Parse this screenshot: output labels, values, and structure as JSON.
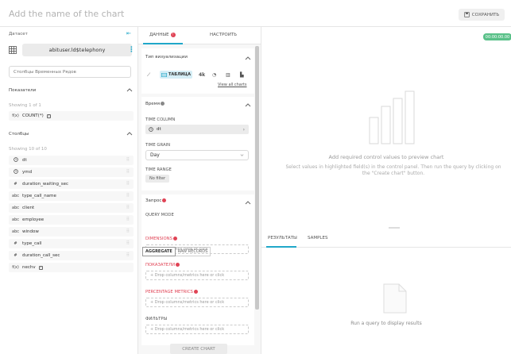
{
  "header": {
    "chart_name": "Add the name of the chart",
    "save_label": "СОХРАНИТЬ"
  },
  "dataset": {
    "label": "Датасет",
    "name": "abituser.ld$telephony"
  },
  "search": {
    "placeholder": "Столбцы Временных Рядов"
  },
  "metrics": {
    "title": "Показатели",
    "showing": "Showing 1 of 1",
    "items": [
      {
        "type": "f(x)",
        "name": "COUNT(*)"
      }
    ]
  },
  "columns": {
    "title": "Столбцы",
    "showing": "Showing 10 of 10",
    "items": [
      {
        "type": "clock",
        "name": "dt"
      },
      {
        "type": "clock",
        "name": "ymd"
      },
      {
        "type": "#",
        "name": "duration_waiting_sec"
      },
      {
        "type": "abc",
        "name": "type_call_name"
      },
      {
        "type": "abc",
        "name": "client"
      },
      {
        "type": "abc",
        "name": "employee"
      },
      {
        "type": "abc",
        "name": "window"
      },
      {
        "type": "#",
        "name": "type_call"
      },
      {
        "type": "#",
        "name": "duration_call_sec"
      },
      {
        "type": "f(x)",
        "name": "nechv"
      }
    ]
  },
  "tabs": {
    "data": "ДАННЫЕ",
    "data_badge": "!",
    "customize": "НАСТРОИТЬ"
  },
  "vis": {
    "title": "Тип визуализации",
    "table_label": "ТАБЛИЦА",
    "num_label": "4k",
    "view_all": "View all charts"
  },
  "time": {
    "title": "Время",
    "time_column_label": "TIME COLUMN",
    "time_column_value": "dt",
    "time_grain_label": "TIME GRAIN",
    "time_grain_value": "Day",
    "time_range_label": "TIME RANGE",
    "time_range_value": "No filter"
  },
  "query": {
    "title": "Запрос",
    "mode_label": "QUERY MODE",
    "mode_aggregate": "AGGREGATE",
    "mode_raw": "RAW RECORDS",
    "dimensions_label": "DIMENSIONS",
    "dimensions_placeholder": "+ Drop columns here or click",
    "metrics_label": "ПОКАЗАТЕЛИ",
    "metrics_placeholder": "+ Drop columns/metrics here or click",
    "pct_label": "PERCENTAGE METRICS",
    "pct_placeholder": "+ Drop columns/metrics here or click",
    "filters_label": "ФИЛЬТРЫ",
    "filters_placeholder": "+ Drop columns/metrics here or click"
  },
  "create_chart_label": "CREATE CHART",
  "preview": {
    "timer": "00:00:00.00",
    "title": "Add required control values to preview chart",
    "text": "Select values in highlighted field(s) in the control panel. Then run the query by clicking on the \"Create chart\" button.",
    "results_tab": "РЕЗУЛЬТАТЫ",
    "samples_tab": "SAMPLES",
    "run_text": "Run a query to display results"
  },
  "colors": {
    "accent": "#20a7c9",
    "error": "#e04355",
    "success": "#5ac189"
  }
}
